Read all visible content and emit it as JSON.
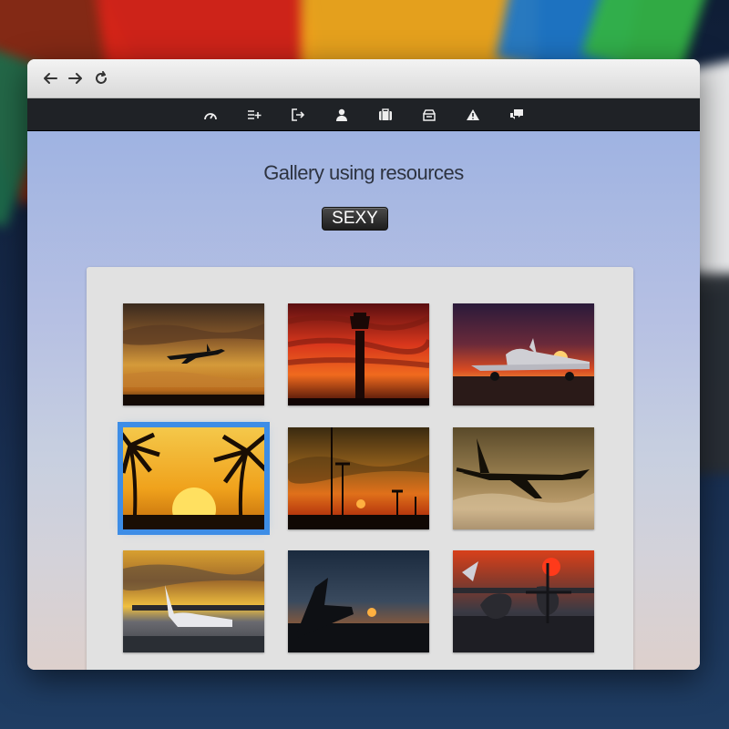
{
  "browser": {
    "back_icon": "arrow-left-icon",
    "forward_icon": "arrow-right-icon",
    "reload_icon": "reload-icon"
  },
  "navbar": {
    "icons": [
      "dashboard-icon",
      "list-add-icon",
      "sign-out-icon",
      "user-icon",
      "briefcase-icon",
      "inbox-icon",
      "warning-icon",
      "chat-icon"
    ]
  },
  "page": {
    "title": "Gallery using resources",
    "badge": "SEXY"
  },
  "gallery": {
    "selected_index": 3,
    "images": [
      "plane-sunset-clouds",
      "control-tower-red-sky",
      "parked-jet-sunset",
      "palm-trees-sunset",
      "light-poles-sunset",
      "plane-landing-dusk",
      "jet-on-tarmac-evening",
      "tail-fin-sunset",
      "propeller-plane-red-sun"
    ]
  },
  "colors": {
    "selection": "#3d8de6",
    "navbar": "#1f2226",
    "badge": "#2a2a2a"
  }
}
